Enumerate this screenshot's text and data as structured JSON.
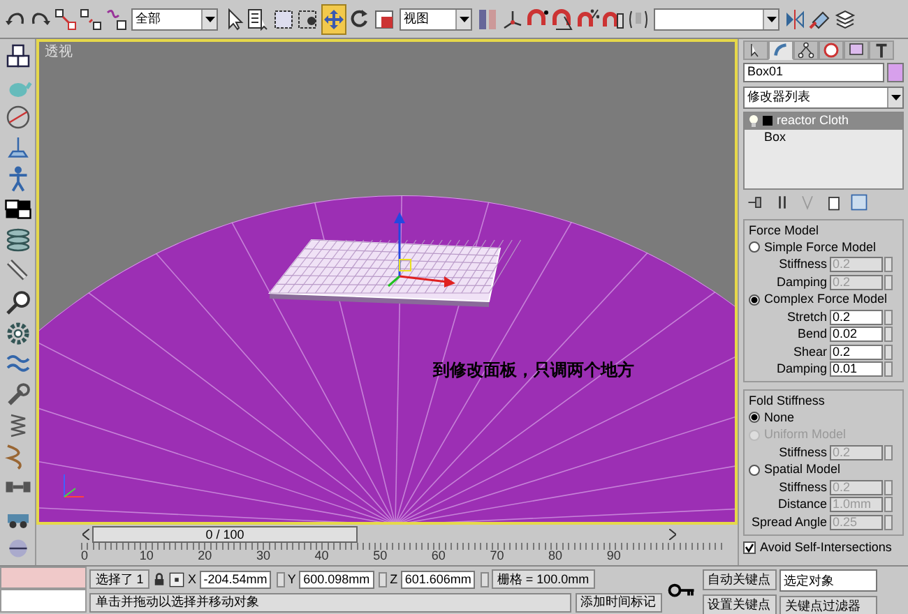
{
  "toolbar": {
    "items": [
      {
        "kind": "icon",
        "selected": false
      },
      {
        "kind": "icon",
        "selected": false
      },
      {
        "kind": "icon",
        "selected": false
      },
      {
        "kind": "icon",
        "selected": false
      },
      {
        "kind": "icon",
        "selected": false
      },
      {
        "kind": "dropdown",
        "value": "全部"
      },
      {
        "kind": "icon",
        "selected": false
      },
      {
        "kind": "icon",
        "selected": false
      },
      {
        "kind": "icon",
        "selected": false
      },
      {
        "kind": "icon",
        "selected": false
      },
      {
        "kind": "icon",
        "selected": true
      },
      {
        "kind": "icon",
        "selected": false
      },
      {
        "kind": "icon",
        "selected": false
      },
      {
        "kind": "dropdown",
        "value": "视图"
      },
      {
        "kind": "icon",
        "selected": false
      },
      {
        "kind": "icon",
        "selected": false
      },
      {
        "kind": "icon",
        "selected": false
      },
      {
        "kind": "icon",
        "selected": false
      },
      {
        "kind": "icon",
        "selected": false
      },
      {
        "kind": "icon",
        "selected": false
      },
      {
        "kind": "icon",
        "selected": false
      },
      {
        "kind": "dropdown"
      },
      {
        "kind": "icon",
        "selected": false
      },
      {
        "kind": "icon",
        "selected": false
      },
      {
        "kind": "icon",
        "selected": false
      }
    ]
  },
  "viewport": {
    "label": "透视",
    "annotation": "到修改面板，只调两个地方"
  },
  "time_slider": {
    "label": "0 / 100",
    "level": 0
  },
  "ruler": {
    "labels": [
      "0",
      "10",
      "20",
      "30",
      "40",
      "50",
      "60",
      "70",
      "80",
      "90"
    ]
  },
  "command_panel": {
    "tabs": [
      {
        "selected": false
      },
      {
        "selected": true
      },
      {
        "selected": false
      },
      {
        "selected": false
      },
      {
        "selected": false
      },
      {
        "selected": false
      }
    ],
    "object_name": "Box01",
    "modifier_list": "修改器列表",
    "stack": [
      {
        "kind": "modifier",
        "label": "reactor Cloth",
        "selected": true
      },
      {
        "kind": "base",
        "label": "Box",
        "selected": false
      }
    ],
    "groups": [
      {
        "title": "Force Model",
        "rows": [
          {
            "kind": "radio",
            "label": "Simple Force Model",
            "selected": false,
            "disabled": false
          },
          {
            "kind": "spinner",
            "label": "Stiffness",
            "value": "0.2",
            "disabled": true
          },
          {
            "kind": "spinner",
            "label": "Damping",
            "value": "0.2",
            "disabled": true
          },
          {
            "kind": "radio",
            "label": "Complex Force Model",
            "selected": true,
            "disabled": false
          },
          {
            "kind": "spinner",
            "label": "Stretch",
            "value": "0.2",
            "disabled": false
          },
          {
            "kind": "spinner",
            "label": "Bend",
            "value": "0.02",
            "disabled": false
          },
          {
            "kind": "spinner",
            "label": "Shear",
            "value": "0.2",
            "disabled": false
          },
          {
            "kind": "spinner",
            "label": "Damping",
            "value": "0.01",
            "disabled": false
          }
        ]
      },
      {
        "title": "Fold Stiffness",
        "rows": [
          {
            "kind": "radio",
            "label": "None",
            "selected": true,
            "disabled": false
          },
          {
            "kind": "radio",
            "label": "Uniform Model",
            "selected": false,
            "disabled": true
          },
          {
            "kind": "spinner",
            "label": "Stiffness",
            "value": "0.2",
            "disabled": true
          },
          {
            "kind": "radio",
            "label": "Spatial Model",
            "selected": false,
            "disabled": false
          },
          {
            "kind": "spinner",
            "label": "Stiffness",
            "value": "0.2",
            "disabled": true
          },
          {
            "kind": "spinner",
            "label": "Distance",
            "value": "1.0mm",
            "disabled": true
          },
          {
            "kind": "spinner",
            "label": "Spread Angle",
            "value": "0.25",
            "disabled": true
          }
        ]
      }
    ],
    "checkbox": {
      "label": "Avoid Self-Intersections",
      "checked": true
    }
  },
  "status_bar": {
    "selection": "选择了 1",
    "coords": [
      {
        "axis": "X",
        "value": "-204.54mm"
      },
      {
        "axis": "Y",
        "value": "600.098mm"
      },
      {
        "axis": "Z",
        "value": "601.606mm"
      }
    ],
    "grid": "栅格 = 100.0mm",
    "prompt": "单击并拖动以选择并移动对象",
    "time_tag": "添加时间标记",
    "auto_key": "自动关键点",
    "set_key": "设置关键点",
    "key_mode": "选定对象",
    "key_filters": "关键点过滤器"
  }
}
